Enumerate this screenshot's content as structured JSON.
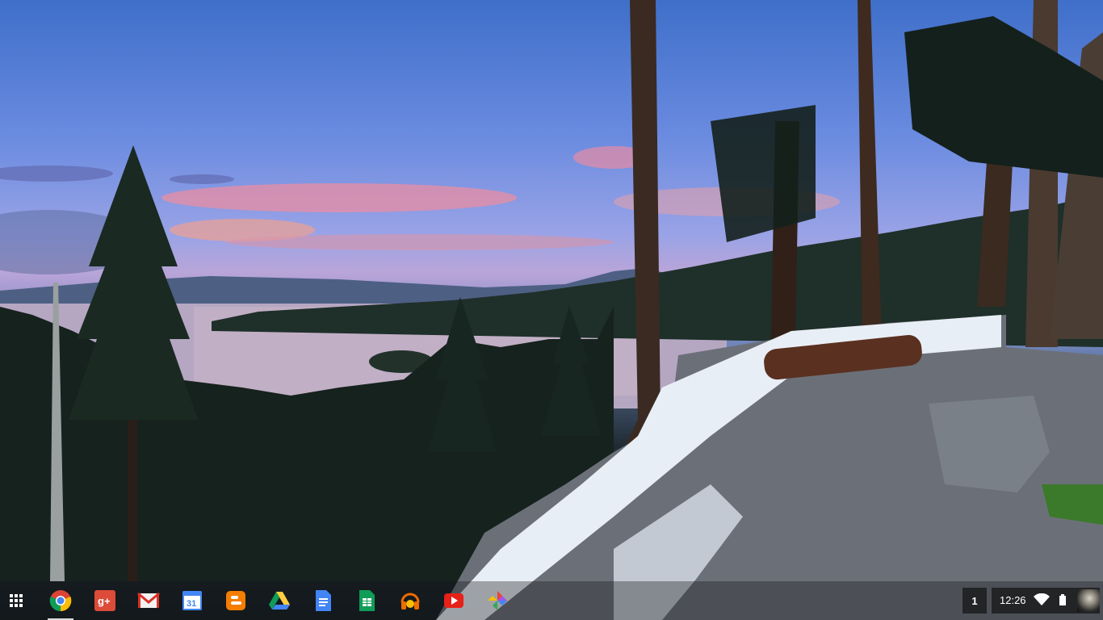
{
  "wallpaper": {
    "description_icon": "mountain-lake-landscape"
  },
  "shelf": {
    "launcher_icon": "app-launcher-grid-icon",
    "apps": [
      {
        "name": "chrome-icon",
        "color": "#db4437"
      },
      {
        "name": "google-plus-icon",
        "color": "#dd4b39",
        "text": "g+"
      },
      {
        "name": "gmail-icon",
        "color": "#d93025"
      },
      {
        "name": "calendar-icon",
        "color": "#4285f4",
        "text": "31"
      },
      {
        "name": "blogger-icon",
        "color": "#f57d00"
      },
      {
        "name": "drive-icon",
        "color": "#0f9d58"
      },
      {
        "name": "docs-icon",
        "color": "#4285f4"
      },
      {
        "name": "sheets-icon",
        "color": "#0f9d58"
      },
      {
        "name": "play-music-icon",
        "color": "#ef6c00"
      },
      {
        "name": "youtube-icon",
        "color": "#e62117"
      },
      {
        "name": "photos-icon",
        "color": "#fbbc05"
      }
    ]
  },
  "tray": {
    "notification_count": "1",
    "time": "12:26",
    "wifi_icon": "wifi-icon",
    "battery_icon": "battery-icon"
  }
}
